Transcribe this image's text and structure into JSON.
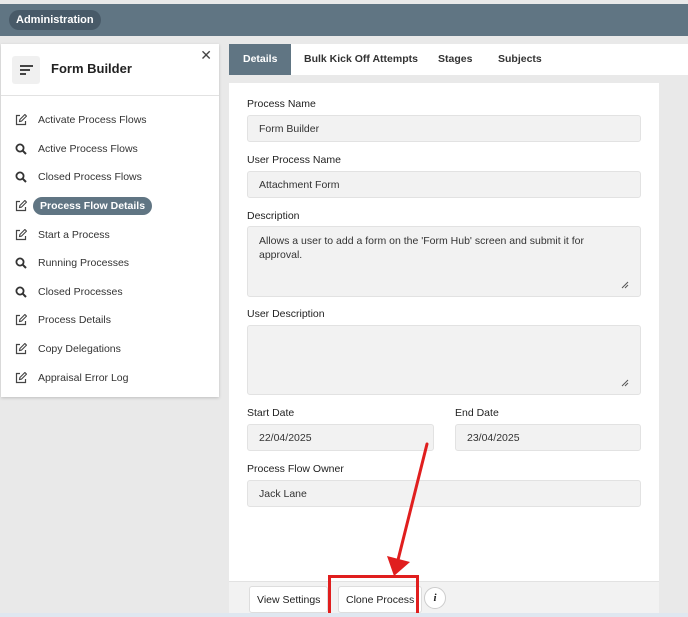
{
  "header": {
    "breadcrumb": "Administration"
  },
  "sidebar": {
    "title": "Form Builder",
    "items": [
      {
        "label": "Activate Process Flows",
        "icon": "edit-icon"
      },
      {
        "label": "Active Process Flows",
        "icon": "search-icon"
      },
      {
        "label": "Closed Process Flows",
        "icon": "search-icon"
      },
      {
        "label": "Process Flow Details",
        "icon": "edit-icon",
        "active": true
      },
      {
        "label": "Start a Process",
        "icon": "edit-icon"
      },
      {
        "label": "Running Processes",
        "icon": "search-icon"
      },
      {
        "label": "Closed Processes",
        "icon": "search-icon"
      },
      {
        "label": "Process Details",
        "icon": "edit-icon"
      },
      {
        "label": "Copy Delegations",
        "icon": "edit-icon"
      },
      {
        "label": "Appraisal Error Log",
        "icon": "edit-icon"
      }
    ]
  },
  "tabs": [
    {
      "label": "Details",
      "active": true
    },
    {
      "label": "Bulk Kick Off Attempts"
    },
    {
      "label": "Stages"
    },
    {
      "label": "Subjects"
    }
  ],
  "form": {
    "process_name_label": "Process Name",
    "process_name_value": "Form Builder",
    "user_process_name_label": "User Process Name",
    "user_process_name_value": "Attachment Form",
    "description_label": "Description",
    "description_value": "Allows a user to add a form on the 'Form Hub' screen and submit it for approval.",
    "user_description_label": "User Description",
    "user_description_value": "",
    "start_date_label": "Start Date",
    "start_date_value": "22/04/2025",
    "end_date_label": "End Date",
    "end_date_value": "23/04/2025",
    "owner_label": "Process Flow Owner",
    "owner_value": "Jack Lane"
  },
  "footer": {
    "view_settings_label": "View Settings",
    "clone_process_label": "Clone Process",
    "info_label": "i"
  },
  "colors": {
    "accent": "#607583",
    "annotation": "#e01e1e"
  }
}
